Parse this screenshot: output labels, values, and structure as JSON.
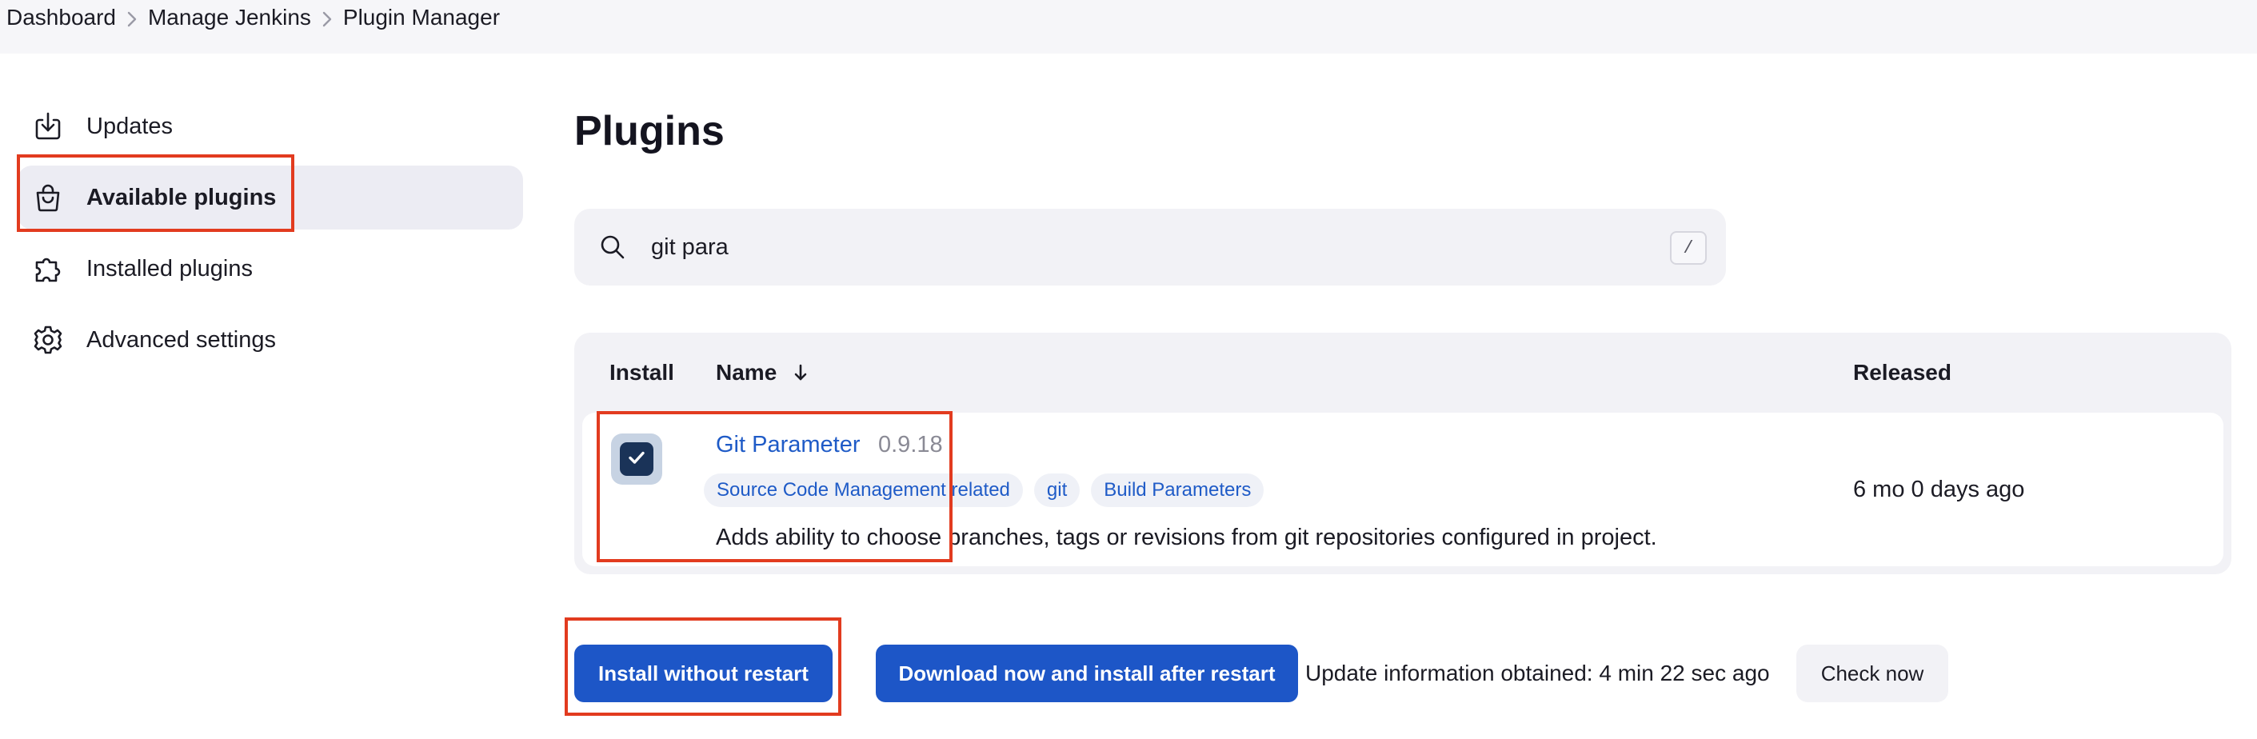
{
  "breadcrumb": {
    "items": [
      {
        "label": "Dashboard"
      },
      {
        "label": "Manage Jenkins"
      },
      {
        "label": "Plugin Manager"
      }
    ]
  },
  "sidebar": {
    "items": [
      {
        "label": "Updates",
        "icon": "download-icon",
        "active": false
      },
      {
        "label": "Available plugins",
        "icon": "shopping-bag-icon",
        "active": true
      },
      {
        "label": "Installed plugins",
        "icon": "puzzle-piece-icon",
        "active": false
      },
      {
        "label": "Advanced settings",
        "icon": "gear-icon",
        "active": false
      }
    ]
  },
  "main": {
    "title": "Plugins",
    "search": {
      "value": "git para",
      "shortcut_hint": "/"
    },
    "table": {
      "columns": {
        "install": "Install",
        "name": "Name",
        "released": "Released"
      },
      "sort_icon": "arrow-down-icon",
      "rows": [
        {
          "checked": true,
          "name": "Git Parameter",
          "version": "0.9.18",
          "tags": [
            "Source Code Management related",
            "git",
            "Build Parameters"
          ],
          "description": "Adds ability to choose branches, tags or revisions from git repositories configured in project.",
          "released": "6 mo 0 days ago"
        }
      ]
    }
  },
  "footer": {
    "install_button": "Install without restart",
    "download_button": "Download now and install after restart",
    "update_info": "Update information obtained: 4 min 22 sec ago",
    "check_button": "Check now"
  },
  "colors": {
    "accent": "#1d56c7",
    "link": "#1f5bc7",
    "highlight_box": "#e23b1f",
    "checkbox": "#1a3358"
  }
}
